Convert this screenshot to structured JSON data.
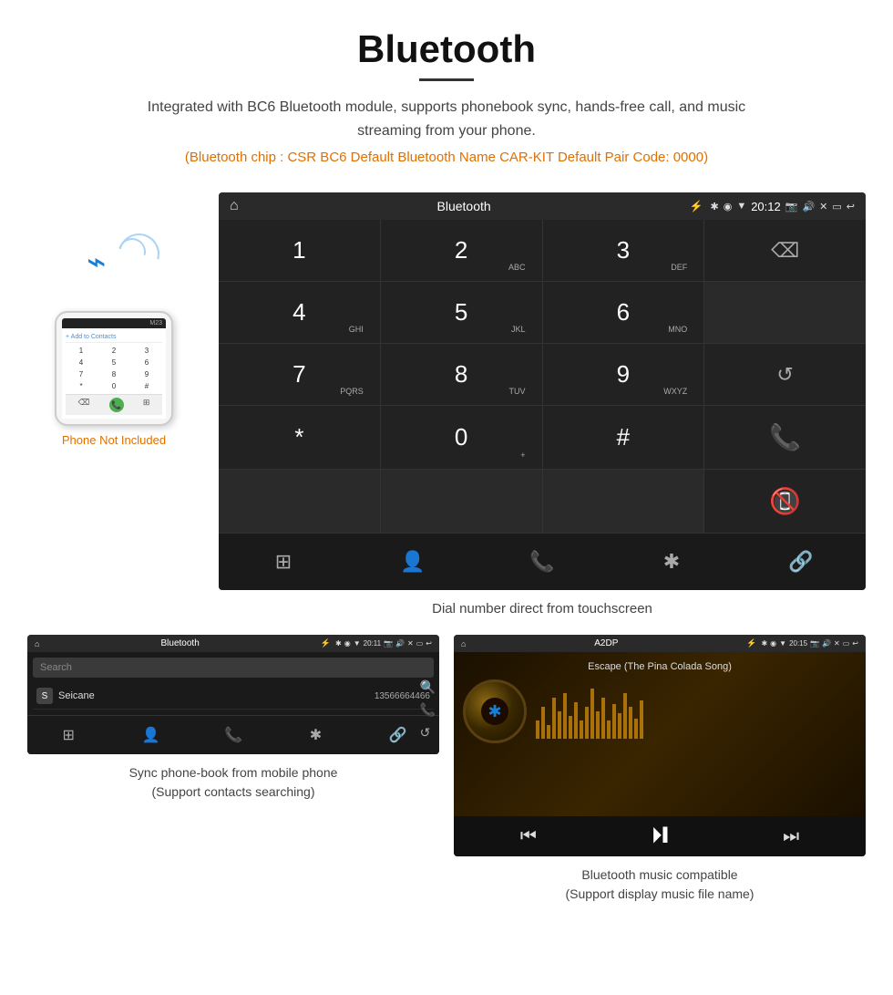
{
  "header": {
    "title": "Bluetooth",
    "description": "Integrated with BC6 Bluetooth module, supports phonebook sync, hands-free call, and music streaming from your phone.",
    "specs": "(Bluetooth chip : CSR BC6    Default Bluetooth Name CAR-KIT    Default Pair Code: 0000)"
  },
  "phone_label": "Phone Not Included",
  "main_screen": {
    "status_bar": {
      "home_icon": "⌂",
      "title": "Bluetooth",
      "usb_icon": "⚡",
      "bt_icon": "✱",
      "location_icon": "◉",
      "signal_icon": "▼",
      "time": "20:12",
      "camera_icon": "📷",
      "volume_icon": "🔊",
      "close_icon": "✕",
      "window_icon": "▭",
      "back_icon": "↩"
    },
    "dialpad": {
      "keys": [
        {
          "num": "1",
          "sub": ""
        },
        {
          "num": "2",
          "sub": "ABC"
        },
        {
          "num": "3",
          "sub": "DEF"
        },
        {
          "num": "",
          "sub": "",
          "type": "backspace"
        },
        {
          "num": "4",
          "sub": "GHI"
        },
        {
          "num": "5",
          "sub": "JKL"
        },
        {
          "num": "6",
          "sub": "MNO"
        },
        {
          "num": "",
          "sub": "",
          "type": "empty"
        },
        {
          "num": "7",
          "sub": "PQRS"
        },
        {
          "num": "8",
          "sub": "TUV"
        },
        {
          "num": "9",
          "sub": "WXYZ"
        },
        {
          "num": "",
          "sub": "",
          "type": "reload"
        },
        {
          "num": "*",
          "sub": ""
        },
        {
          "num": "0",
          "sub": "+"
        },
        {
          "num": "#",
          "sub": ""
        },
        {
          "num": "",
          "sub": "",
          "type": "call_green"
        }
      ]
    },
    "bottom_nav": [
      "⊞",
      "👤",
      "📞",
      "✱",
      "🔗"
    ]
  },
  "dial_caption": "Dial number direct from touchscreen",
  "phonebook_panel": {
    "status": {
      "home": "⌂",
      "title": "Bluetooth",
      "usb": "⚡",
      "bt": "✱",
      "loc": "◉",
      "sig": "▼",
      "time": "20:11",
      "cam": "📷",
      "vol": "🔊",
      "x": "✕",
      "win": "▭",
      "back": "↩"
    },
    "search_placeholder": "Search",
    "contacts": [
      {
        "initial": "S",
        "name": "Seicane",
        "number": "13566664466"
      }
    ],
    "right_icons": [
      "🔍",
      "📞",
      "↺"
    ],
    "bottom_nav": [
      "⊞",
      "👤",
      "📞",
      "✱",
      "🔗"
    ]
  },
  "phonebook_caption": "Sync phone-book from mobile phone\n(Support contacts searching)",
  "music_panel": {
    "status": {
      "home": "⌂",
      "title": "A2DP",
      "usb": "⚡",
      "bt": "✱",
      "loc": "◉",
      "sig": "▼",
      "time": "20:15",
      "cam": "📷",
      "vol": "🔊",
      "x": "✕",
      "win": "▭",
      "back": "↩"
    },
    "song_title": "Escape (The Pina Colada Song)",
    "bt_icon": "✱",
    "controls": {
      "prev": "⏮",
      "play_pause": "⏵❙",
      "next": "⏭"
    },
    "visualizer_heights": [
      20,
      35,
      15,
      45,
      30,
      50,
      25,
      40,
      20,
      35,
      55,
      30,
      45,
      20,
      38,
      28,
      50,
      35,
      22,
      42
    ]
  },
  "music_caption": "Bluetooth music compatible\n(Support display music file name)"
}
